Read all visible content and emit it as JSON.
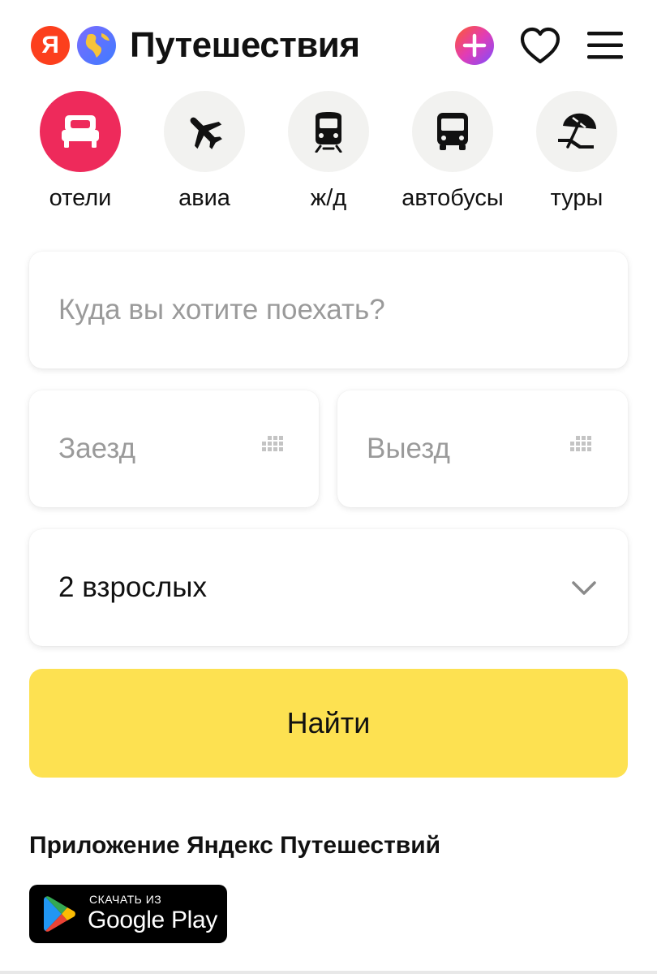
{
  "header": {
    "ya_logo_letter": "Я",
    "title": "Путешествия",
    "icons": {
      "plus": "plus-badge-icon",
      "favorites": "heart-icon",
      "menu": "hamburger-menu-icon"
    }
  },
  "categories": [
    {
      "label": "отели",
      "icon": "bed-icon",
      "active": true
    },
    {
      "label": "авиа",
      "icon": "airplane-icon",
      "active": false
    },
    {
      "label": "ж/д",
      "icon": "train-icon",
      "active": false
    },
    {
      "label": "автобусы",
      "icon": "bus-icon",
      "active": false
    },
    {
      "label": "туры",
      "icon": "beach-umbrella-icon",
      "active": false
    }
  ],
  "form": {
    "destination_placeholder": "Куда вы хотите поехать?",
    "checkin_placeholder": "Заезд",
    "checkout_placeholder": "Выезд",
    "guests_value": "2 взрослых",
    "search_button": "Найти"
  },
  "app_promo": {
    "heading": "Приложение Яндекс Путешествий",
    "store_small": "СКАЧАТЬ ИЗ",
    "store_big": "Google Play"
  },
  "colors": {
    "accent_active": "#ee2a5b",
    "button_yellow": "#fde151",
    "yandex_red": "#fc3f1d",
    "placeholder_gray": "#9a9a9a"
  }
}
